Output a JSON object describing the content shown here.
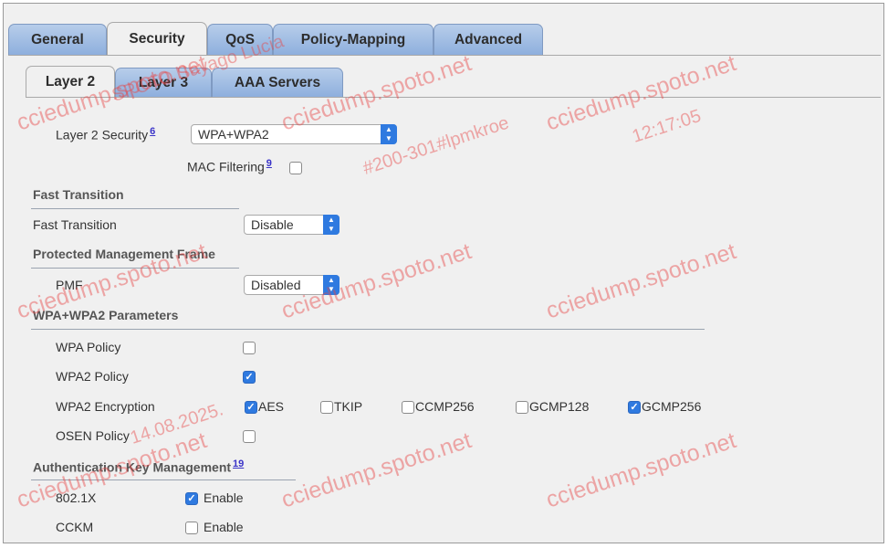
{
  "tabs": [
    "General",
    "Security",
    "QoS",
    "Policy-Mapping",
    "Advanced"
  ],
  "active_tab": "Security",
  "subtabs": [
    "Layer 2",
    "Layer 3",
    "AAA Servers"
  ],
  "active_subtab": "Layer 2",
  "layer2": {
    "security_label": "Layer 2 Security",
    "security_sup": "6",
    "security_value": "WPA+WPA2",
    "mac_filtering_label": "MAC Filtering",
    "mac_filtering_sup": "9",
    "mac_filtering_checked": false
  },
  "fast_transition": {
    "section_title": "Fast Transition",
    "label": "Fast Transition",
    "value": "Disable"
  },
  "pmf": {
    "section_title": "Protected Management Frame",
    "label": "PMF",
    "value": "Disabled"
  },
  "wpa_params": {
    "section_title": "WPA+WPA2 Parameters",
    "wpa_policy_label": "WPA Policy",
    "wpa_policy_checked": false,
    "wpa2_policy_label": "WPA2 Policy",
    "wpa2_policy_checked": true,
    "encryption_label": "WPA2 Encryption",
    "encryption_options": [
      {
        "label": "AES",
        "checked": true
      },
      {
        "label": "TKIP",
        "checked": false
      },
      {
        "label": "CCMP256",
        "checked": false
      },
      {
        "label": "GCMP128",
        "checked": false
      },
      {
        "label": "GCMP256",
        "checked": true
      }
    ],
    "osen_policy_label": "OSEN Policy",
    "osen_policy_checked": false
  },
  "akm": {
    "section_title": "Authentication Key Management",
    "section_sup": "19",
    "rows": [
      {
        "label": "802.1X",
        "option": "Enable",
        "checked": true
      },
      {
        "label": "CCKM",
        "option": "Enable",
        "checked": false
      }
    ]
  },
  "watermark": {
    "brand": "cciedump.spoto.net",
    "name": "SPOTO Sayago Lucia",
    "exam": "#200-301#lpmkroe",
    "date": "14.08.2025.",
    "time": "12:17:05"
  },
  "colors": {
    "tab_blue": "#a3bfe6",
    "accent_blue": "#2f7ae0",
    "watermark": "#e64646"
  }
}
